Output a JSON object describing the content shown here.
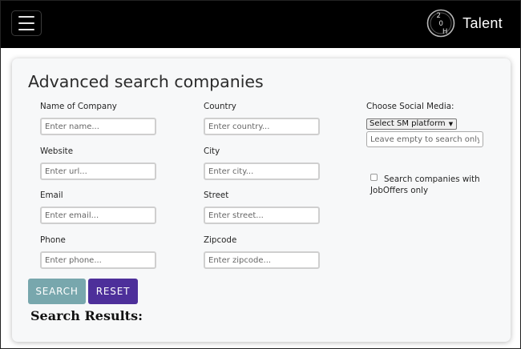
{
  "navbar": {
    "menu_icon": "hamburger-menu-icon",
    "logo_icon": "h2o-logo-icon",
    "logo_marks": {
      "top": "2",
      "middle": "0",
      "bottom": "H"
    },
    "brand": "Talent",
    "background": "#000000"
  },
  "card": {
    "title": "Advanced search companies",
    "fields": {
      "name": {
        "label": "Name of Company",
        "placeholder": "Enter name..."
      },
      "website": {
        "label": "Website",
        "placeholder": "Enter url..."
      },
      "email": {
        "label": "Email",
        "placeholder": "Enter email..."
      },
      "phone": {
        "label": "Phone",
        "placeholder": "Enter phone..."
      },
      "country": {
        "label": "Country",
        "placeholder": "Enter country..."
      },
      "city": {
        "label": "City",
        "placeholder": "Enter city..."
      },
      "street": {
        "label": "Street",
        "placeholder": "Enter street..."
      },
      "zipcode": {
        "label": "Zipcode",
        "placeholder": "Enter zipcode..."
      }
    },
    "social_media": {
      "label": "Choose Social Media:",
      "select_value": "Select SM platform",
      "input_placeholder": "Leave empty to search only platform"
    },
    "joboffers_checkbox": {
      "label": "Search companies with JobOffers only",
      "checked": false
    },
    "buttons": {
      "search": "SEARCH",
      "reset": "RESET"
    },
    "results_heading": "Search Results:"
  },
  "colors": {
    "search_button": "#78a7ad",
    "reset_button": "#4d2f9a",
    "card_background": "#f7f8f9"
  }
}
